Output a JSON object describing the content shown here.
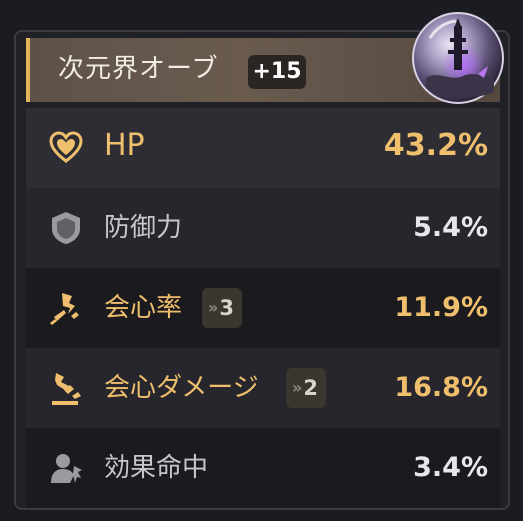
{
  "header": {
    "title": "次元界オーブ",
    "level": "+15"
  },
  "orb_icon": "planar-orb-icon",
  "stats": [
    {
      "icon": "heart-icon",
      "label": "HP",
      "value": "43.2%",
      "highlight": true
    },
    {
      "icon": "shield-icon",
      "label": "防御力",
      "value": "5.4%",
      "highlight": false
    },
    {
      "icon": "crit-rate-icon",
      "label": "会心率",
      "upgrades_arrow": "»",
      "upgrades": "3",
      "value": "11.9%",
      "highlight": false
    },
    {
      "icon": "crit-damage-icon",
      "label": "会心ダメージ",
      "upgrades_arrow": "»",
      "upgrades": "2",
      "value": "16.8%",
      "highlight": false
    },
    {
      "icon": "effect-hit-icon",
      "label": "効果命中",
      "value": "3.4%",
      "highlight": false
    }
  ],
  "colors": {
    "gold": "#f0bf6e",
    "accent_bar": "#e6b45a",
    "text_white": "#e7e7ea"
  }
}
